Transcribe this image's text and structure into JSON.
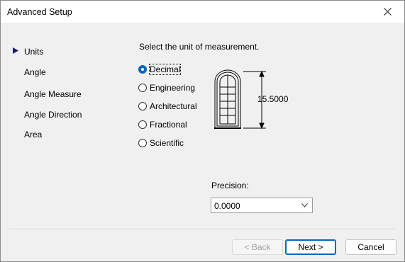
{
  "window": {
    "title": "Advanced Setup"
  },
  "sidebar": {
    "items": [
      {
        "label": "Units",
        "active": true
      },
      {
        "label": "Angle"
      },
      {
        "label": "Angle Measure"
      },
      {
        "label": "Angle Direction"
      },
      {
        "label": "Area"
      }
    ]
  },
  "units": {
    "prompt": "Select the unit of measurement.",
    "options": [
      {
        "label": "Decimal",
        "checked": true
      },
      {
        "label": "Engineering"
      },
      {
        "label": "Architectural"
      },
      {
        "label": "Fractional"
      },
      {
        "label": "Scientific"
      }
    ],
    "preview_value": "15.5000"
  },
  "precision": {
    "label": "Precision:",
    "value": "0.0000"
  },
  "buttons": {
    "back": "< Back",
    "next": "Next >",
    "cancel": "Cancel"
  },
  "colors": {
    "accent": "#0067c0",
    "sidebar_arrow": "#1a1a6e"
  }
}
